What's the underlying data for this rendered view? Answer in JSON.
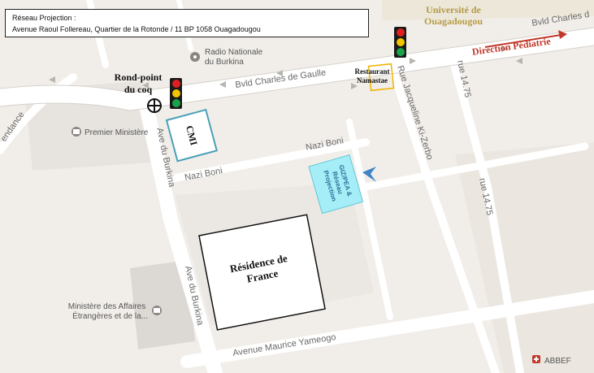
{
  "info": {
    "title": "Réseau Projection :",
    "address": "Avenue Raoul Follereau, Quartier de la Rotonde / 11 BP 1058 Ouagadougou"
  },
  "roads": {
    "bvld_main": "Bvld Charles de Gaulle",
    "bvld_east": "Bvld Charles d",
    "nazi_boni_1": "Nazi Boni",
    "nazi_boni_2": "Nazi Boni",
    "ave_burkina_top": "Ave du Burkina",
    "ave_burkina_bottom": "Ave du Burkina",
    "rue_ki_zerbo": "Rue Jacqueline Ki-Zerbo",
    "rue_1475_top": "rue 14.75",
    "rue_1475_right": "rue 14.75",
    "ave_yameogo": "Avenue Maurice Yameogo",
    "left_edge": "endance"
  },
  "places": {
    "radio": "Radio Nationale\ndu Burkina",
    "premier": "Premier Ministère",
    "ministere": "Ministère des Affaires\nÉtrangères et de la...",
    "abbef": "ABBEF"
  },
  "annotations": {
    "universite": "Université de\nOuagadougou",
    "direction": "Direction Pédiatrie",
    "rond_point": "Rond-point\ndu coq",
    "restaurant": "Restaurant\nNamastae",
    "cmi": "CMI",
    "giz": "GIZ/PEA &\nRéseau\nProjection",
    "residence": "Résidence de\nFrance"
  },
  "colors": {
    "background": "#f1eee9",
    "road": "#ffffff",
    "block": "#e6e3de",
    "direction_arrow": "#c0392b",
    "cmi_border": "#4aa0b8",
    "giz_fill": "#a6eef7",
    "marker": "#3d85c6",
    "restaurant_border": "#f0b400"
  }
}
